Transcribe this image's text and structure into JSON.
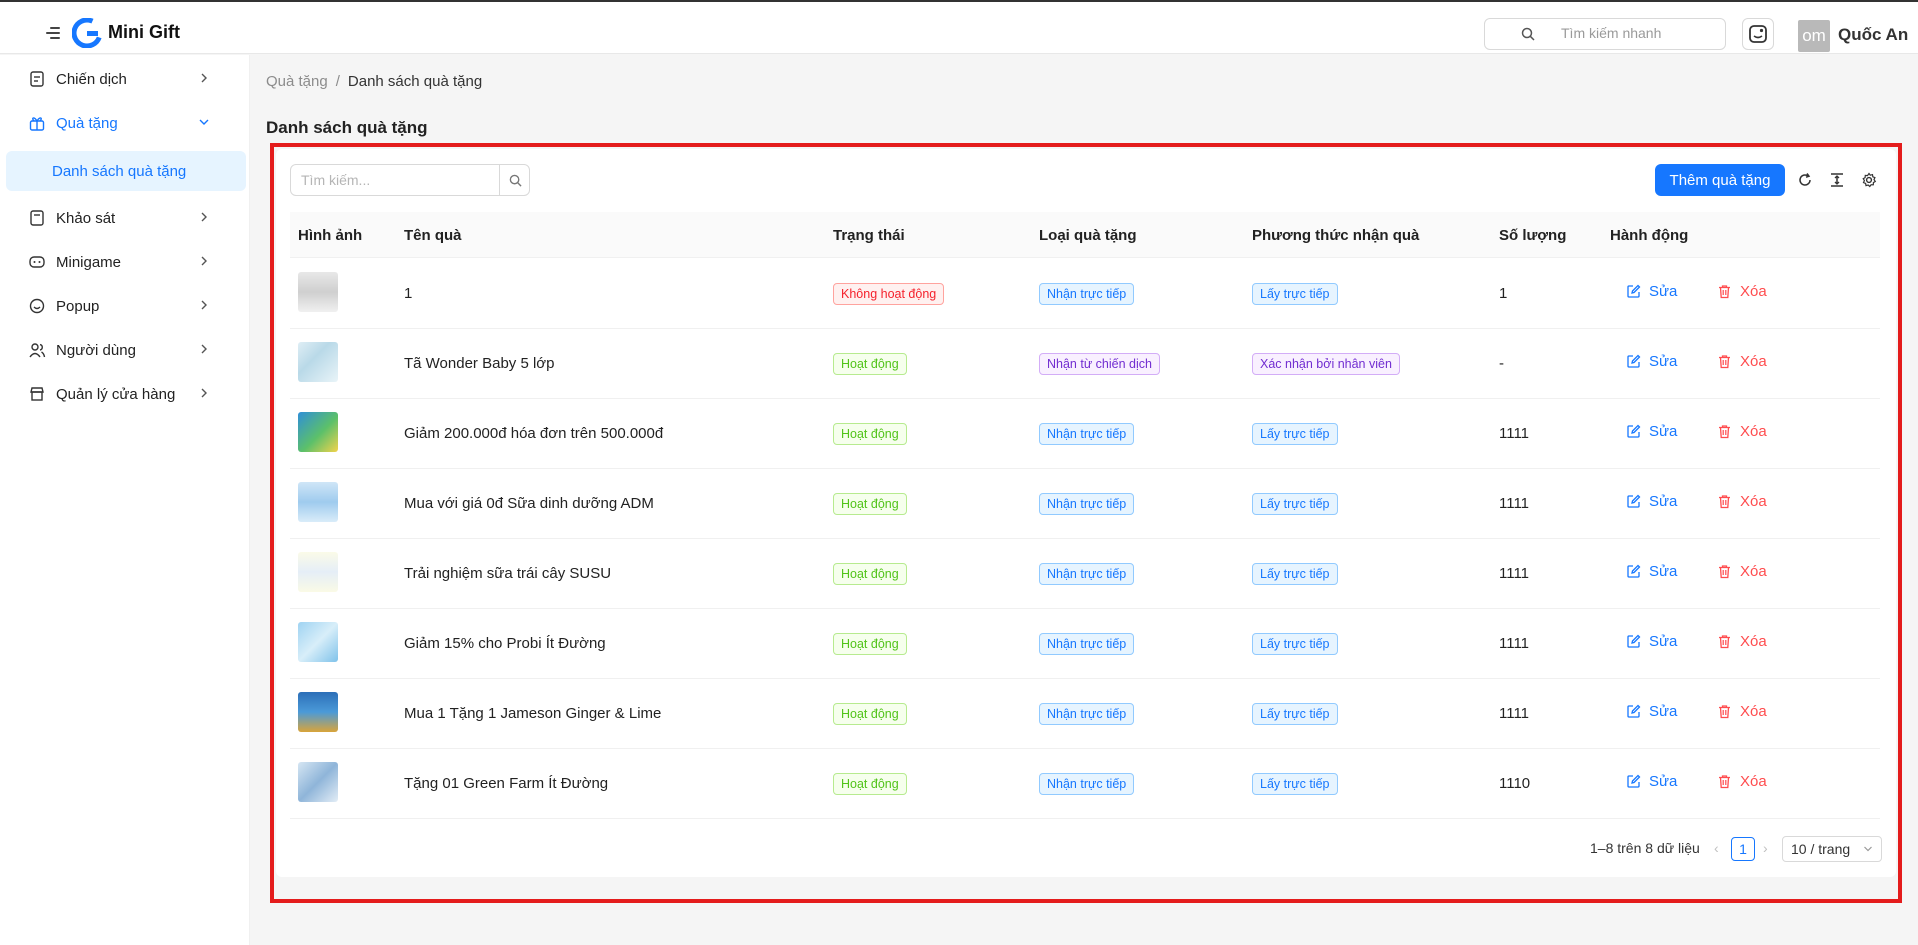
{
  "app": {
    "name": "Mini Gift",
    "logo_letter": "G"
  },
  "header": {
    "search_placeholder": "Tìm kiếm nhanh",
    "avatar_initials": "om",
    "user_name": "Quốc An"
  },
  "sidebar": {
    "items": [
      {
        "label": "Chiến dịch",
        "icon": "campaign-icon"
      },
      {
        "label": "Quà tặng",
        "icon": "gift-icon",
        "active": true,
        "expanded": true
      },
      {
        "label": "Khảo sát",
        "icon": "survey-icon"
      },
      {
        "label": "Minigame",
        "icon": "game-icon"
      },
      {
        "label": "Popup",
        "icon": "popup-icon"
      },
      {
        "label": "Người dùng",
        "icon": "users-icon"
      },
      {
        "label": "Quản lý cửa hàng",
        "icon": "store-icon"
      }
    ],
    "sub_item": "Danh sách quà tặng"
  },
  "breadcrumb": {
    "parent": "Quà tặng",
    "separator": "/",
    "current": "Danh sách quà tặng"
  },
  "page_title": "Danh sách quà tặng",
  "toolbar": {
    "search_placeholder": "Tìm kiếm...",
    "add_label": "Thêm quà tặng"
  },
  "table": {
    "headers": [
      "Hình ảnh",
      "Tên quà",
      "Trạng thái",
      "Loại quà tặng",
      "Phương thức nhận quà",
      "Số lượng",
      "Hành động"
    ],
    "edit_label": "Sửa",
    "delete_label": "Xóa",
    "rows": [
      {
        "name": "1",
        "status": "Không hoạt động",
        "type": "Nhận trực tiếp",
        "method": "Lấy trực tiếp",
        "qty": "1"
      },
      {
        "name": "Tã Wonder Baby 5 lớp",
        "status": "Hoạt động",
        "type": "Nhận từ chiến dịch",
        "method": "Xác nhận bởi nhân viên",
        "qty": "-"
      },
      {
        "name": "Giảm 200.000đ hóa đơn trên 500.000đ",
        "status": "Hoạt động",
        "type": "Nhận trực tiếp",
        "method": "Lấy trực tiếp",
        "qty": "1111"
      },
      {
        "name": "Mua với giá 0đ Sữa dinh dưỡng ADM",
        "status": "Hoạt động",
        "type": "Nhận trực tiếp",
        "method": "Lấy trực tiếp",
        "qty": "1111"
      },
      {
        "name": "Trải nghiệm sữa trái cây SUSU",
        "status": "Hoạt động",
        "type": "Nhận trực tiếp",
        "method": "Lấy trực tiếp",
        "qty": "1111"
      },
      {
        "name": "Giảm 15% cho Probi Ít Đường",
        "status": "Hoạt động",
        "type": "Nhận trực tiếp",
        "method": "Lấy trực tiếp",
        "qty": "1111"
      },
      {
        "name": "Mua 1 Tặng 1 Jameson Ginger & Lime",
        "status": "Hoạt động",
        "type": "Nhận trực tiếp",
        "method": "Lấy trực tiếp",
        "qty": "1111"
      },
      {
        "name": "Tặng 01 Green Farm Ít Đường",
        "status": "Hoạt động",
        "type": "Nhận trực tiếp",
        "method": "Lấy trực tiếp",
        "qty": "1110"
      }
    ]
  },
  "pagination": {
    "info": "1–8 trên 8 dữ liệu",
    "current_page": "1",
    "page_size": "10 / trang"
  },
  "colors": {
    "primary": "#1677ff",
    "danger": "#ff4d4f",
    "success": "#52c41a",
    "purple": "#722ed1",
    "highlight_border": "#e41c1c"
  }
}
